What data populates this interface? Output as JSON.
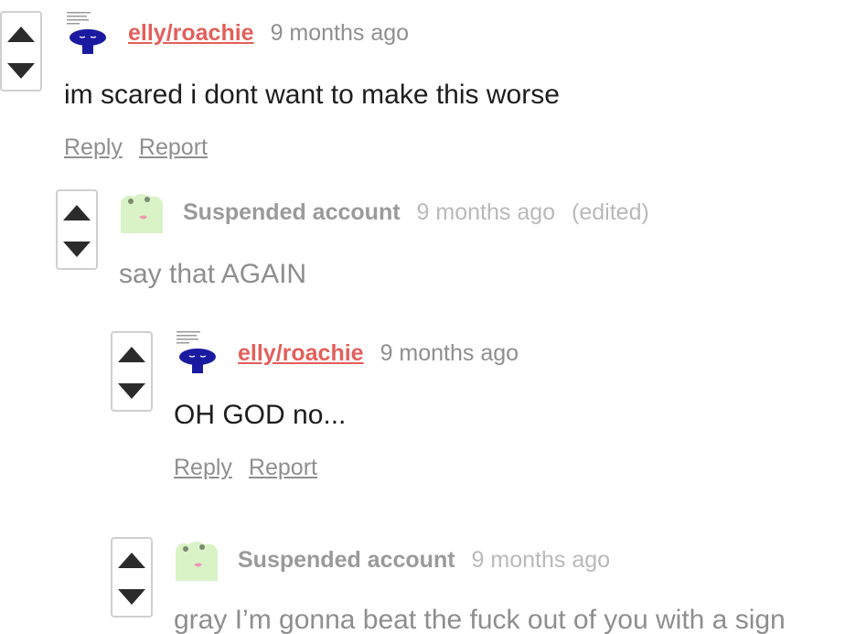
{
  "colors": {
    "username": "#e35f5b",
    "suspended_name": "#9a9a9a",
    "timestamp": "#8f8f8f",
    "timestamp_light": "#b9b9b9",
    "body_dark": "#1d1d1d",
    "body_gray": "#8e8e8e",
    "vote_border": "#cfcfcf",
    "vote_arrow": "#2b2b2b"
  },
  "comments": [
    {
      "author": "elly/roachie",
      "author_type": "user",
      "timestamp": "9 months ago",
      "body": "im scared i dont want to make this worse",
      "actions": {
        "reply": "Reply",
        "report": "Report"
      },
      "icons": {
        "upvote": "upvote-arrow-icon",
        "downvote": "downvote-arrow-icon",
        "avatar": "blue-blob-avatar"
      }
    },
    {
      "author": "Suspended account",
      "author_type": "suspended",
      "timestamp": "9 months ago",
      "edited": "(edited)",
      "body": "say that AGAIN",
      "icons": {
        "upvote": "upvote-arrow-icon",
        "downvote": "downvote-arrow-icon",
        "avatar": "green-frog-avatar"
      }
    },
    {
      "author": "elly/roachie",
      "author_type": "user",
      "timestamp": "9 months ago",
      "body": "OH GOD no...",
      "actions": {
        "reply": "Reply",
        "report": "Report"
      },
      "icons": {
        "upvote": "upvote-arrow-icon",
        "downvote": "downvote-arrow-icon",
        "avatar": "blue-blob-avatar"
      }
    },
    {
      "author": "Suspended account",
      "author_type": "suspended",
      "timestamp": "9 months ago",
      "body": "gray I’m gonna beat the fuck out of you with a sign",
      "icons": {
        "upvote": "upvote-arrow-icon",
        "downvote": "downvote-arrow-icon",
        "avatar": "green-frog-avatar"
      }
    }
  ]
}
